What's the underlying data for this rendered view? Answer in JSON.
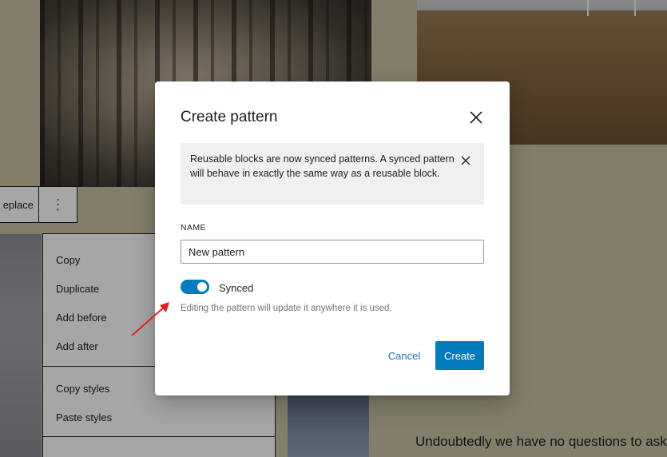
{
  "toolbar": {
    "replace_label": "eplace",
    "options_glyph": "⋮"
  },
  "block_menu": {
    "items": [
      "Copy",
      "Duplicate",
      "Add before",
      "Add after",
      "Copy styles",
      "Paste styles"
    ]
  },
  "canvas": {
    "paragraph_text": "Undoubtedly we have no questions to ask"
  },
  "modal": {
    "title": "Create pattern",
    "close_icon": "close-icon",
    "notice": {
      "text": "Reusable blocks are now synced patterns. A synced pattern will behave in exactly the same way as a reusable block.",
      "dismiss_icon": "close-icon"
    },
    "name_label": "NAME",
    "name_value": "New pattern",
    "synced": {
      "label": "Synced",
      "enabled": true,
      "help": "Editing the pattern will update it anywhere it is used."
    },
    "cancel_label": "Cancel",
    "create_label": "Create"
  },
  "colors": {
    "accent": "#007cba",
    "link": "#2271b1",
    "annotation": "#e02020",
    "overlay": "rgba(0,0,0,0.35)"
  }
}
